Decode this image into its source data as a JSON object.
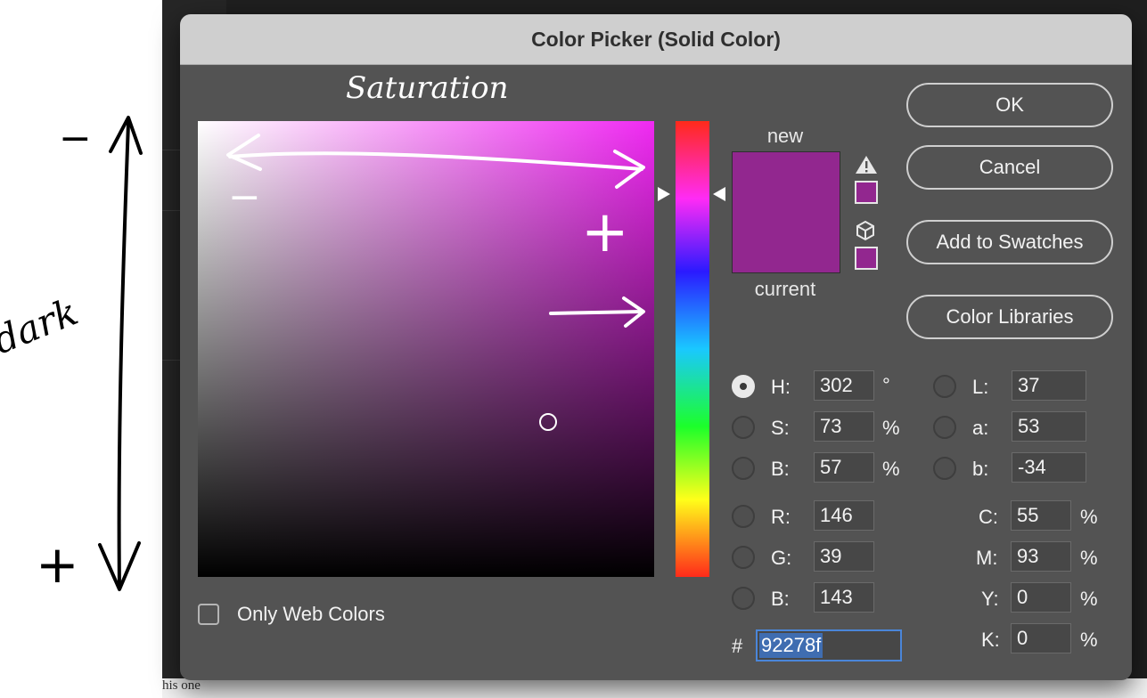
{
  "dialog": {
    "title": "Color Picker (Solid Color)",
    "buttons": {
      "ok": "OK",
      "cancel": "Cancel",
      "add_to_swatches": "Add to Swatches",
      "color_libraries": "Color Libraries"
    },
    "swatch": {
      "new_label": "new",
      "current_label": "current",
      "new_color": "#92278f",
      "current_color": "#92278f"
    },
    "icons": {
      "gamut_warning": "warning-triangle-icon",
      "web_safe": "cube-icon"
    },
    "fields": {
      "h": {
        "label": "H:",
        "value": "302",
        "unit": "°",
        "selected": true
      },
      "s": {
        "label": "S:",
        "value": "73",
        "unit": "%"
      },
      "b_hsb": {
        "label": "B:",
        "value": "57",
        "unit": "%"
      },
      "r": {
        "label": "R:",
        "value": "146"
      },
      "g": {
        "label": "G:",
        "value": "39"
      },
      "b_rgb": {
        "label": "B:",
        "value": "143"
      },
      "l": {
        "label": "L:",
        "value": "37"
      },
      "a": {
        "label": "a:",
        "value": "53"
      },
      "b_lab": {
        "label": "b:",
        "value": "-34"
      },
      "c": {
        "label": "C:",
        "value": "55",
        "unit": "%"
      },
      "m": {
        "label": "M:",
        "value": "93",
        "unit": "%"
      },
      "y": {
        "label": "Y:",
        "value": "0",
        "unit": "%"
      },
      "k": {
        "label": "K:",
        "value": "0",
        "unit": "%"
      }
    },
    "hex": {
      "symbol": "#",
      "value": "92278f"
    },
    "only_web_colors": {
      "label": "Only Web Colors",
      "checked": false
    }
  },
  "annotations": {
    "saturation": "Saturation",
    "dark": "dark",
    "minus": "−",
    "plus": "+"
  },
  "background": {
    "bottom_text": "his one"
  }
}
